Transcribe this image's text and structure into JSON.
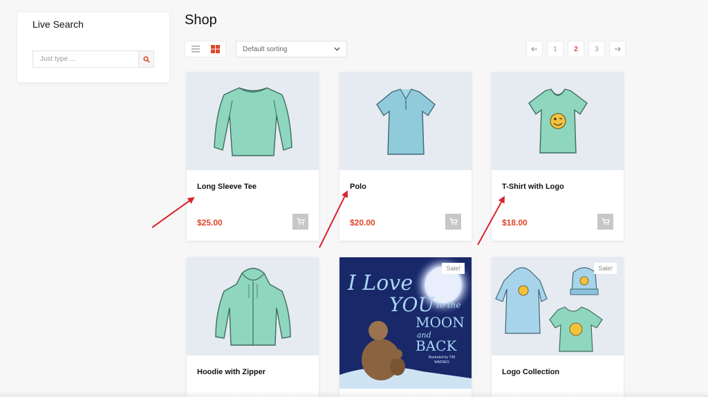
{
  "sidebar": {
    "widget_title": "Live Search",
    "search_placeholder": "Just type ..."
  },
  "main": {
    "title": "Shop",
    "sort_selected": "Default sorting",
    "pagination": {
      "prev_icon": "arrow-left-icon",
      "pages": [
        "1",
        "2",
        "3"
      ],
      "current": "2",
      "next_icon": "arrow-right-icon"
    }
  },
  "products": [
    {
      "name": "Long Sleeve Tee",
      "price": "$25.00",
      "image": "long-sleeve-tee"
    },
    {
      "name": "Polo",
      "price": "$20.00",
      "image": "polo-shirt"
    },
    {
      "name": "T-Shirt with Logo",
      "price": "$18.00",
      "image": "tshirt-logo"
    },
    {
      "name": "Hoodie with Zipper",
      "price": "",
      "image": "hoodie-zipper"
    },
    {
      "name": "",
      "price": "",
      "image": "book-cover",
      "badge": "Sale!"
    },
    {
      "name": "Logo Collection",
      "price": "",
      "image": "logo-collection",
      "badge": "Sale!"
    }
  ],
  "book_cover": {
    "line1": "I Love",
    "line2": "YOU",
    "line3": "to the",
    "line4": "MOON",
    "line5": "and",
    "line6": "BACK",
    "credit": "Illustrated by TIM WARNES"
  },
  "colors": {
    "accent": "#e0452a",
    "annotation_arrow": "#d9232d",
    "product_bg": "#e6ebf1",
    "garment": "#8fd6be"
  }
}
